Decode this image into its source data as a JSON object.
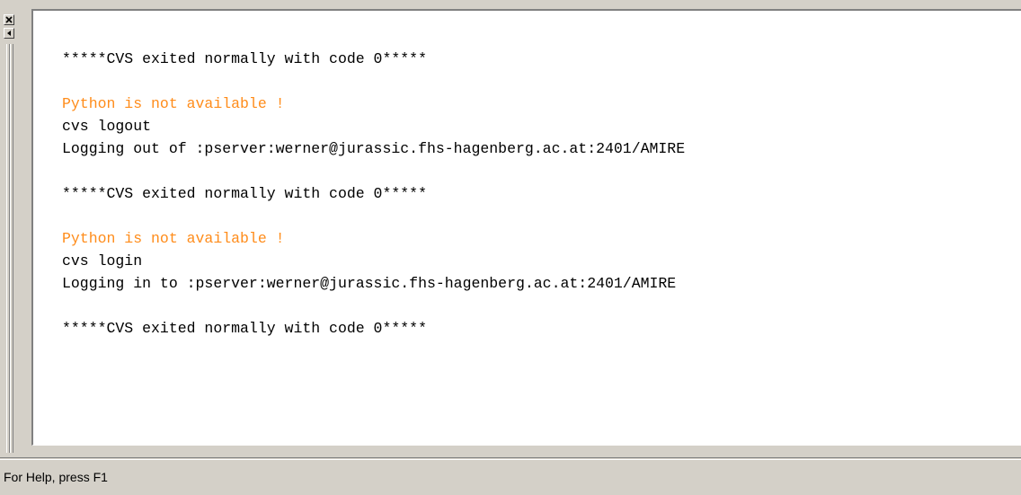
{
  "output": {
    "lines": [
      {
        "text": "*****CVS exited normally with code 0*****",
        "kind": "normal"
      },
      {
        "text": "",
        "kind": "normal"
      },
      {
        "text": "Python is not available !",
        "kind": "warn"
      },
      {
        "text": "cvs logout",
        "kind": "normal"
      },
      {
        "text": "Logging out of :pserver:werner@jurassic.fhs-hagenberg.ac.at:2401/AMIRE",
        "kind": "normal"
      },
      {
        "text": "",
        "kind": "normal"
      },
      {
        "text": "*****CVS exited normally with code 0*****",
        "kind": "normal"
      },
      {
        "text": "",
        "kind": "normal"
      },
      {
        "text": "Python is not available !",
        "kind": "warn"
      },
      {
        "text": "cvs login",
        "kind": "normal"
      },
      {
        "text": "Logging in to :pserver:werner@jurassic.fhs-hagenberg.ac.at:2401/AMIRE",
        "kind": "normal"
      },
      {
        "text": "",
        "kind": "normal"
      },
      {
        "text": "*****CVS exited normally with code 0*****",
        "kind": "normal"
      }
    ]
  },
  "statusbar": {
    "help_text": "For Help, press F1"
  },
  "icons": {
    "close": "close-icon",
    "restore": "restore-icon"
  },
  "colors": {
    "warning_text": "#ff8c1a",
    "background": "#d4d0c8"
  }
}
